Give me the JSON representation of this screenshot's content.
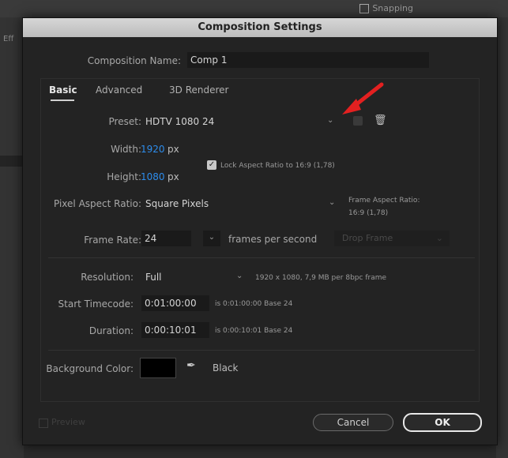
{
  "background": {
    "snapping_label": "Snapping",
    "left_label": "Eff"
  },
  "dialog": {
    "title": "Composition Settings",
    "composition_name_label": "Composition Name:",
    "composition_name_value": "Comp 1",
    "tabs": [
      {
        "label": "Basic",
        "active": true
      },
      {
        "label": "Advanced",
        "active": false
      },
      {
        "label": "3D Renderer",
        "active": false
      }
    ],
    "preset": {
      "label": "Preset:",
      "value": "HDTV 1080 24"
    },
    "width": {
      "label": "Width:",
      "value": "1920",
      "unit": "px"
    },
    "height": {
      "label": "Height:",
      "value": "1080",
      "unit": "px"
    },
    "lock_aspect": {
      "checked": true,
      "label": "Lock Aspect Ratio to 16:9 (1,78)"
    },
    "pixel_aspect": {
      "label": "Pixel Aspect Ratio:",
      "value": "Square Pixels"
    },
    "frame_aspect": {
      "label": "Frame Aspect Ratio:",
      "value": "16:9 (1,78)"
    },
    "frame_rate": {
      "label": "Frame Rate:",
      "value": "24",
      "unit_label": "frames per second",
      "drop_frame": "Drop Frame"
    },
    "resolution": {
      "label": "Resolution:",
      "value": "Full",
      "info": "1920 x 1080, 7,9 MB per 8bpc frame"
    },
    "start_timecode": {
      "label": "Start Timecode:",
      "value": "0:01:00:00",
      "info": "is 0:01:00:00  Base 24"
    },
    "duration": {
      "label": "Duration:",
      "value": "0:00:10:01",
      "info": "is 0:00:10:01  Base 24"
    },
    "background_color": {
      "label": "Background Color:",
      "swatch": "#000000",
      "name": "Black"
    },
    "preview_label": "Preview",
    "cancel_label": "Cancel",
    "ok_label": "OK"
  },
  "colors": {
    "accent_blue": "#2d8ceb",
    "arrow_red": "#e32020"
  }
}
